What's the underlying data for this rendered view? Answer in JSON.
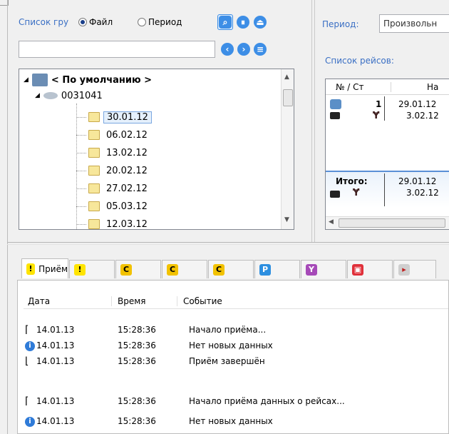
{
  "left_panel": {
    "group_list_label": "Список гру",
    "radio_file": "Файл",
    "radio_period": "Период",
    "search_value": "",
    "tree": {
      "root": "< По умолчанию >",
      "device": "0031041",
      "dates": [
        "30.01.12",
        "06.02.12",
        "13.02.12",
        "20.02.12",
        "27.02.12",
        "05.03.12",
        "12.03.12"
      ]
    }
  },
  "right_panel": {
    "period_label": "Период:",
    "period_value": "Произвольн",
    "flights_label": "Список рейсов:",
    "columns": [
      "№ / Ст",
      "На"
    ],
    "rows": [
      {
        "num": "1",
        "date1": "29.01.12",
        "date2": "3.02.12"
      }
    ],
    "total_label": "Итого:",
    "total_date1": "29.01.12",
    "total_date2": "3.02.12"
  },
  "tabs": [
    {
      "badge": "!",
      "label": "Приём",
      "color": "#ffe400",
      "text_color": "#000"
    },
    {
      "badge": "!",
      "label": "",
      "color": "#ffe400",
      "text_color": "#000"
    },
    {
      "badge": "C",
      "label": "",
      "color": "#f2c200",
      "text_color": "#000"
    },
    {
      "badge": "C",
      "label": "",
      "color": "#f2c200",
      "text_color": "#000"
    },
    {
      "badge": "C",
      "label": "",
      "color": "#f2c200",
      "text_color": "#000"
    },
    {
      "badge": "P",
      "label": "",
      "color": "#2d8fe0",
      "text_color": "#fff"
    },
    {
      "badge": "Y",
      "label": "",
      "color": "#a64ab8",
      "text_color": "#fff"
    },
    {
      "badge": "▣",
      "label": "",
      "color": "#e0303a",
      "text_color": "#fff"
    }
  ],
  "log": {
    "columns": [
      "Дата",
      "Время",
      "Событие"
    ],
    "rows": [
      {
        "icon": "bracket-start",
        "date": "14.01.13",
        "time": "15:28:36",
        "event": "Начало приёма..."
      },
      {
        "icon": "info",
        "date": "14.01.13",
        "time": "15:28:36",
        "event": "Нет новых данных"
      },
      {
        "icon": "bracket-end",
        "date": "14.01.13",
        "time": "15:28:36",
        "event": "Приём завершён"
      },
      {
        "icon": "bracket-start",
        "date": "14.01.13",
        "time": "15:28:36",
        "event": "Начало приёма данных о рейсах..."
      },
      {
        "icon": "info",
        "date": "14.01.13",
        "time": "15:28:36",
        "event": "Нет новых данных"
      }
    ]
  }
}
